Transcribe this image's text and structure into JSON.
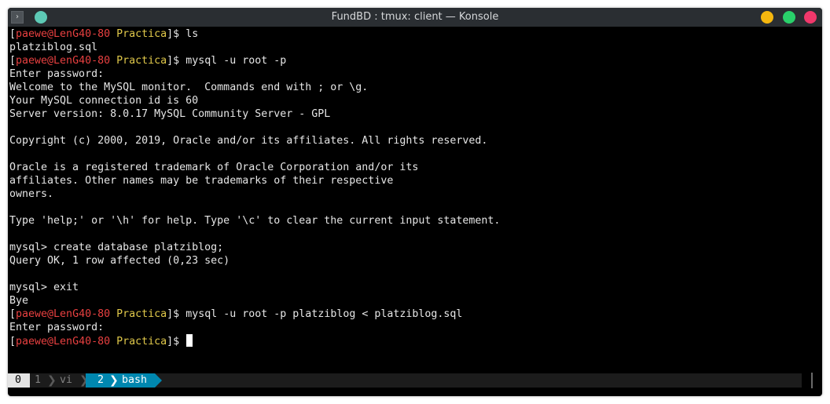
{
  "window": {
    "title": "FundBD : tmux: client — Konsole",
    "menu_glyph": "›"
  },
  "prompt": {
    "open": "[",
    "user_host": "paewe@LenG40-80",
    "dir": "Practica",
    "close": "]$ "
  },
  "terminal": {
    "lines": [
      {
        "type": "prompt",
        "cmd": "ls"
      },
      {
        "type": "text",
        "text": "platziblog.sql"
      },
      {
        "type": "prompt",
        "cmd": "mysql -u root -p"
      },
      {
        "type": "text",
        "text": "Enter password:"
      },
      {
        "type": "text",
        "text": "Welcome to the MySQL monitor.  Commands end with ; or \\g."
      },
      {
        "type": "text",
        "text": "Your MySQL connection id is 60"
      },
      {
        "type": "text",
        "text": "Server version: 8.0.17 MySQL Community Server - GPL"
      },
      {
        "type": "text",
        "text": ""
      },
      {
        "type": "text",
        "text": "Copyright (c) 2000, 2019, Oracle and/or its affiliates. All rights reserved."
      },
      {
        "type": "text",
        "text": ""
      },
      {
        "type": "text",
        "text": "Oracle is a registered trademark of Oracle Corporation and/or its"
      },
      {
        "type": "text",
        "text": "affiliates. Other names may be trademarks of their respective"
      },
      {
        "type": "text",
        "text": "owners."
      },
      {
        "type": "text",
        "text": ""
      },
      {
        "type": "text",
        "text": "Type 'help;' or '\\h' for help. Type '\\c' to clear the current input statement."
      },
      {
        "type": "text",
        "text": ""
      },
      {
        "type": "text",
        "text": "mysql> create database platziblog;"
      },
      {
        "type": "text",
        "text": "Query OK, 1 row affected (0,23 sec)"
      },
      {
        "type": "text",
        "text": ""
      },
      {
        "type": "text",
        "text": "mysql> exit"
      },
      {
        "type": "text",
        "text": "Bye"
      },
      {
        "type": "prompt",
        "cmd": "mysql -u root -p platziblog < platziblog.sql"
      },
      {
        "type": "text",
        "text": "Enter password:"
      },
      {
        "type": "prompt",
        "cmd": "",
        "cursor": true
      }
    ]
  },
  "tmux": {
    "session": "0",
    "windows": [
      {
        "index": "1",
        "name": "vi",
        "active": false
      },
      {
        "index": "2",
        "name": "bash",
        "active": true
      }
    ],
    "separator": "❯"
  },
  "colors": {
    "background": "#000000",
    "foreground": "#e6e6e6",
    "user_host": "#e84040",
    "directory": "#e0c84a",
    "tmux_active": "#0087af",
    "minimize": "#f5b70f",
    "maximize": "#29d06a",
    "close": "#f0386b",
    "pin": "#5dc9b5"
  },
  "icons": {
    "menu": "terminal-menu-icon",
    "pin": "pin-icon",
    "minimize": "minimize-icon",
    "maximize": "maximize-icon",
    "close": "close-icon"
  }
}
